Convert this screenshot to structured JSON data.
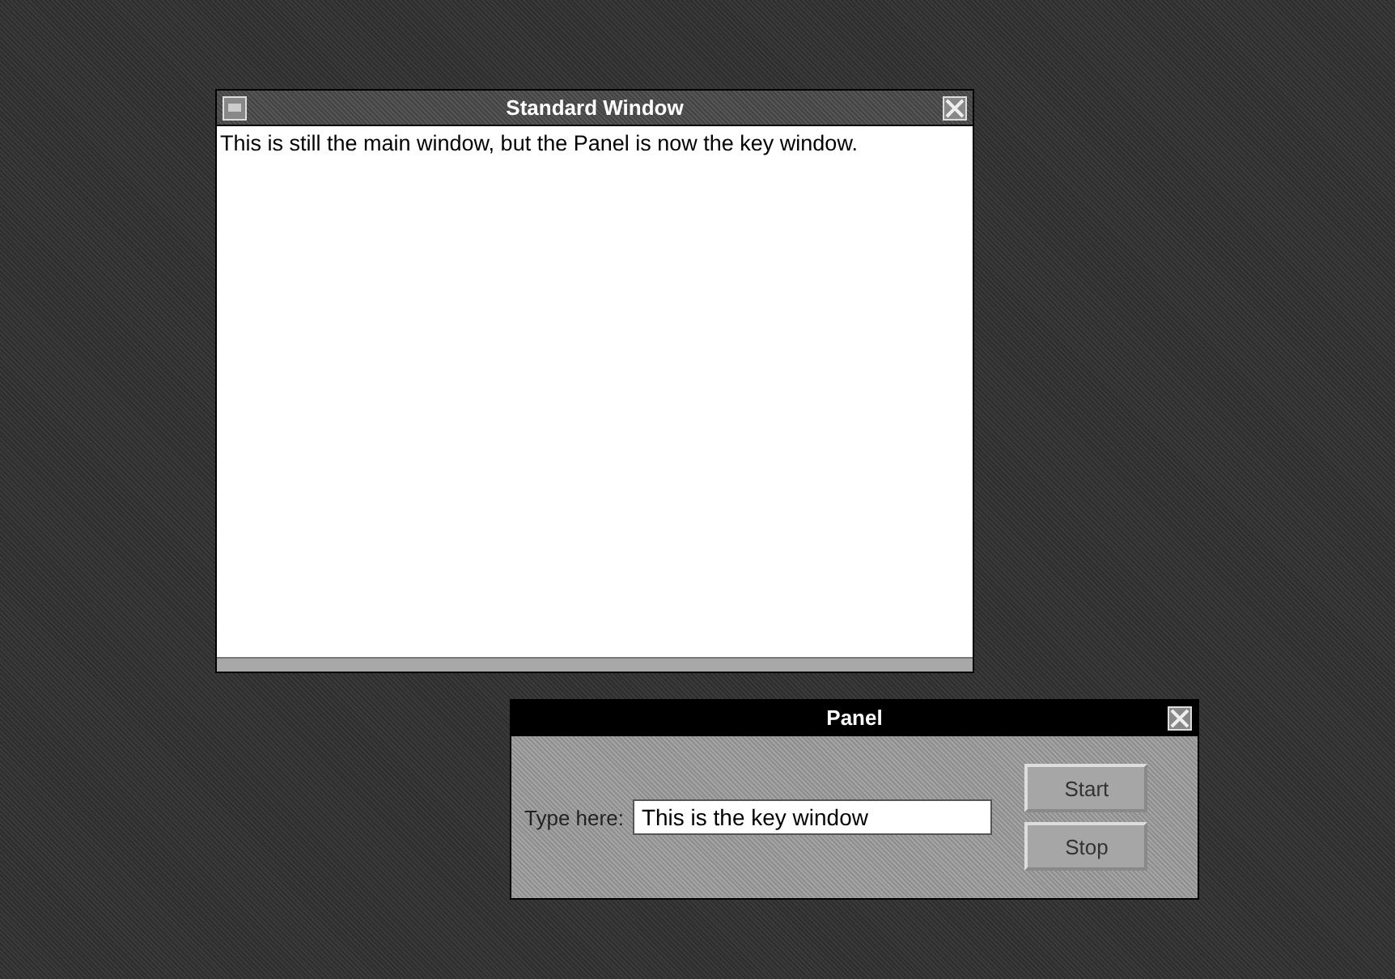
{
  "main_window": {
    "title": "Standard Window",
    "key": false,
    "text": "This is still the main window, but the Panel is now the key window."
  },
  "panel": {
    "title": "Panel",
    "key": true,
    "label": "Type here:",
    "field_value": "This is the key window",
    "buttons": [
      "Start",
      "Stop"
    ]
  }
}
